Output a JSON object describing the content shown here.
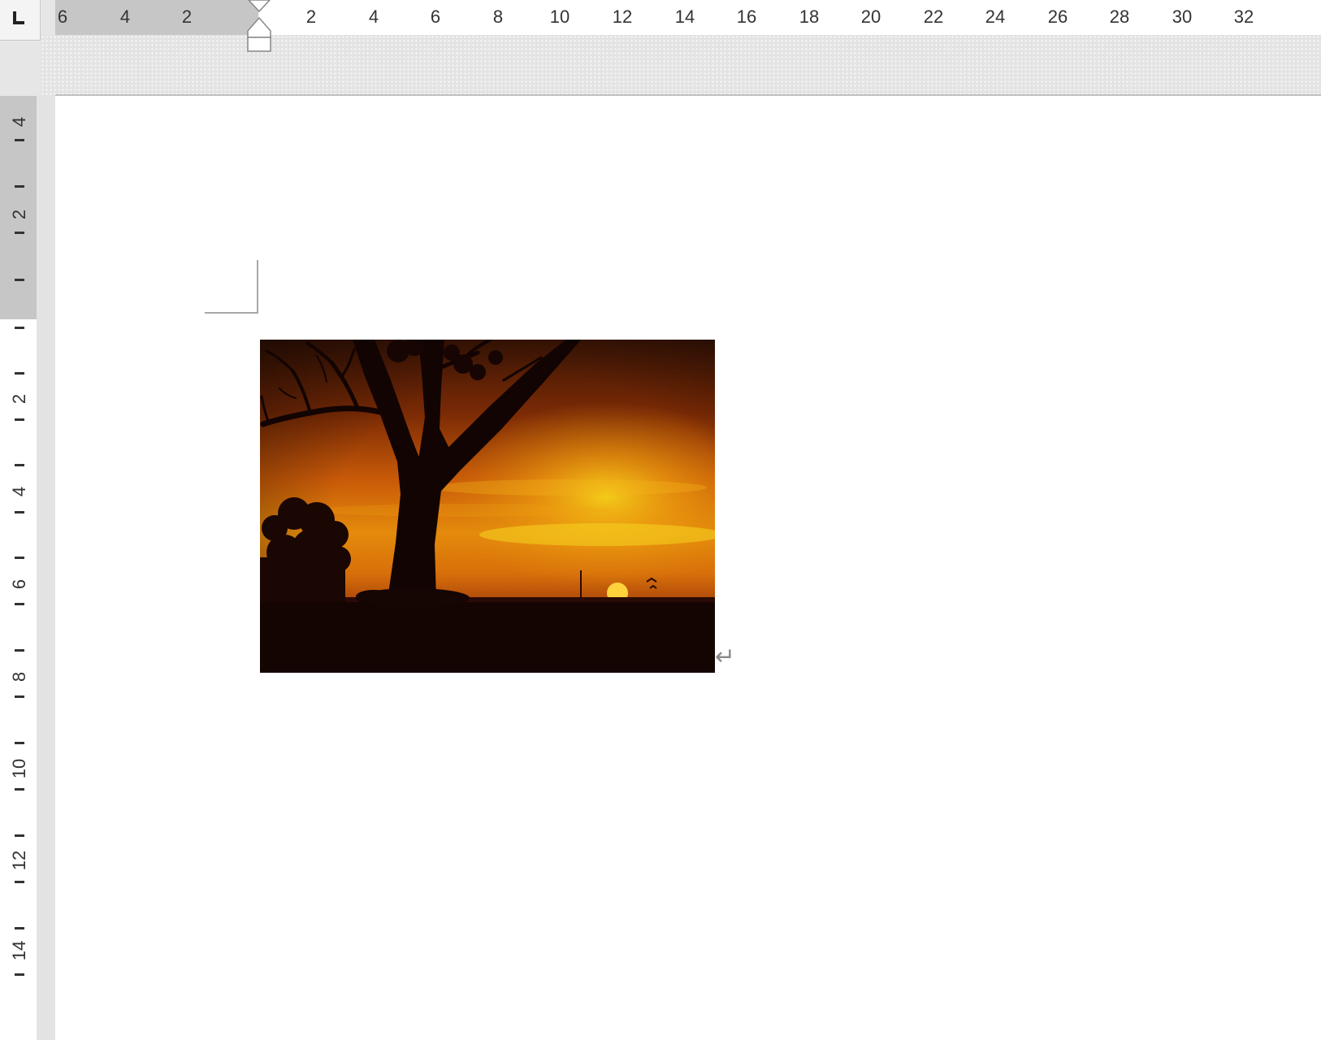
{
  "window": {
    "title": ""
  },
  "horizontal_ruler": {
    "left_margin_labels": [
      "6",
      "4",
      "2"
    ],
    "labels": [
      "2",
      "4",
      "6",
      "8",
      "10",
      "12",
      "14",
      "16",
      "18",
      "20",
      "22",
      "24",
      "26",
      "28",
      "30",
      "32"
    ],
    "margin_color": "#c6c6c6"
  },
  "vertical_ruler": {
    "top_margin_labels": [
      "4",
      "2"
    ],
    "labels": [
      "2",
      "4",
      "6",
      "8",
      "10",
      "12",
      "14"
    ]
  },
  "document": {
    "paragraph_mark": "↵",
    "image": {
      "subject": "sunset-tree-silhouette-photo",
      "colors": {
        "sky_top": "#3a1405",
        "sky_mid": "#c85a08",
        "sky_glow": "#f2b90f",
        "ground": "#140503",
        "sun": "#ffd23c"
      }
    }
  },
  "icons": {
    "tab_selector": "left-tab-icon",
    "first_line_indent": "first-line-indent-marker-icon",
    "hanging_indent": "hanging-indent-marker-icon"
  }
}
